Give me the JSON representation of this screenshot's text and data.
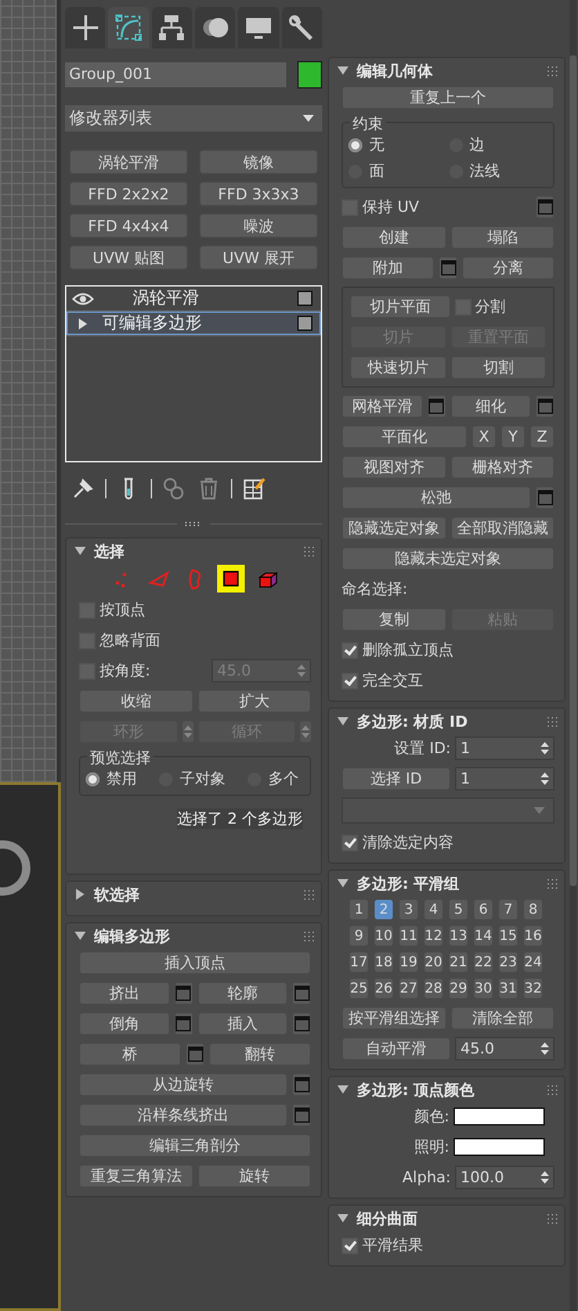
{
  "command_tabs": [
    {
      "kind": "create",
      "selected": false
    },
    {
      "kind": "modify",
      "selected": true
    },
    {
      "kind": "hierarchy",
      "selected": false
    },
    {
      "kind": "motion",
      "selected": false
    },
    {
      "kind": "display",
      "selected": false
    },
    {
      "kind": "utilities",
      "selected": false
    }
  ],
  "object": {
    "name": "Group_001",
    "color": "#2db82d"
  },
  "modifier_list": {
    "value": "修改器列表"
  },
  "modifier_buttons": [
    "涡轮平滑",
    "镜像",
    "FFD 2x2x2",
    "FFD 3x3x3",
    "FFD 4x4x4",
    "噪波",
    "UVW 贴图",
    "UVW 展开"
  ],
  "modifier_stack": [
    {
      "kind": "modifier",
      "label": "涡轮平滑",
      "selected": false
    },
    {
      "kind": "base",
      "label": "可编辑多边形",
      "selected": true
    }
  ],
  "left_rollouts": [
    {
      "title": "选择",
      "expanded": true,
      "rows": [
        {
          "kind": "subobjects",
          "levels": [
            {
              "kind": "vertex",
              "selected": false
            },
            {
              "kind": "edge",
              "selected": false
            },
            {
              "kind": "border",
              "selected": false
            },
            {
              "kind": "polygon",
              "selected": true
            },
            {
              "kind": "element",
              "selected": false
            }
          ]
        },
        {
          "kind": "row",
          "items": [
            {
              "kind": "checkbox",
              "label": "按顶点",
              "checked": false
            }
          ]
        },
        {
          "kind": "row",
          "items": [
            {
              "kind": "checkbox",
              "label": "忽略背面",
              "checked": false
            }
          ]
        },
        {
          "kind": "row",
          "items": [
            {
              "kind": "checkbox",
              "label": "按角度:",
              "checked": false
            },
            {
              "kind": "spinner",
              "value": "45.0",
              "disabled": true
            }
          ]
        },
        {
          "kind": "row",
          "items": [
            {
              "kind": "button",
              "label": "收缩",
              "disabled": false
            },
            {
              "kind": "button",
              "label": "扩大",
              "disabled": false
            }
          ]
        },
        {
          "kind": "row",
          "items": [
            {
              "kind": "button",
              "label": "环形",
              "disabled": true
            },
            {
              "kind": "stepper",
              "disabled": true
            },
            {
              "kind": "button",
              "label": "循环",
              "disabled": true
            },
            {
              "kind": "stepper",
              "disabled": true
            }
          ]
        },
        {
          "kind": "radios",
          "title": "预览选择",
          "options": [
            {
              "label": "禁用",
              "selected": true
            },
            {
              "label": "子对象",
              "selected": false
            },
            {
              "label": "多个",
              "selected": false
            }
          ]
        },
        {
          "kind": "status",
          "text": "选择了 2 个多边形"
        }
      ]
    },
    {
      "title": "软选择",
      "expanded": false
    },
    {
      "title": "编辑多边形",
      "expanded": true,
      "rows": [
        {
          "kind": "row",
          "items": [
            {
              "kind": "button",
              "label": "插入顶点",
              "disabled": false
            }
          ]
        },
        {
          "kind": "row",
          "items": [
            {
              "kind": "button",
              "label": "挤出",
              "disabled": false
            },
            {
              "kind": "settings",
              "disabled": false
            },
            {
              "kind": "button",
              "label": "轮廓",
              "disabled": false
            },
            {
              "kind": "settings",
              "disabled": false
            }
          ]
        },
        {
          "kind": "row",
          "items": [
            {
              "kind": "button",
              "label": "倒角",
              "disabled": false
            },
            {
              "kind": "settings",
              "disabled": false
            },
            {
              "kind": "button",
              "label": "插入",
              "disabled": false
            },
            {
              "kind": "settings",
              "disabled": false
            }
          ]
        },
        {
          "kind": "row",
          "items": [
            {
              "kind": "button",
              "label": "桥",
              "disabled": false
            },
            {
              "kind": "settings",
              "disabled": false
            },
            {
              "kind": "button",
              "label": "翻转",
              "disabled": false
            }
          ]
        },
        {
          "kind": "row",
          "items": [
            {
              "kind": "button",
              "label": "从边旋转",
              "disabled": false
            },
            {
              "kind": "settings",
              "disabled": false
            }
          ]
        },
        {
          "kind": "row",
          "items": [
            {
              "kind": "button",
              "label": "沿样条线挤出",
              "disabled": false
            },
            {
              "kind": "settings",
              "disabled": false
            }
          ]
        },
        {
          "kind": "row",
          "items": [
            {
              "kind": "button",
              "label": "编辑三角剖分",
              "disabled": false
            }
          ]
        },
        {
          "kind": "row",
          "items": [
            {
              "kind": "button",
              "label": "重复三角算法",
              "disabled": false
            },
            {
              "kind": "button",
              "label": "旋转",
              "disabled": false
            }
          ]
        }
      ]
    }
  ],
  "right_rollouts": [
    {
      "title": "编辑几何体",
      "expanded": true,
      "rows": [
        {
          "kind": "row",
          "items": [
            {
              "kind": "button",
              "label": "重复上一个",
              "disabled": false
            }
          ]
        },
        {
          "kind": "radios",
          "title": "约束",
          "options": [
            {
              "label": "无",
              "selected": true
            },
            {
              "label": "边",
              "selected": false
            },
            {
              "label": "面",
              "selected": false
            },
            {
              "label": "法线",
              "selected": false
            }
          ]
        },
        {
          "kind": "row",
          "items": [
            {
              "kind": "checkbox",
              "label": "保持 UV",
              "checked": false
            },
            {
              "kind": "settings",
              "disabled": false
            }
          ]
        },
        {
          "kind": "row",
          "items": [
            {
              "kind": "button",
              "label": "创建",
              "disabled": false
            },
            {
              "kind": "button",
              "label": "塌陷",
              "disabled": false
            }
          ]
        },
        {
          "kind": "row",
          "items": [
            {
              "kind": "button",
              "label": "附加",
              "disabled": false
            },
            {
              "kind": "settings",
              "disabled": false
            },
            {
              "kind": "button",
              "label": "分离",
              "disabled": false
            }
          ]
        },
        {
          "kind": "frame",
          "rows": [
            {
              "kind": "row",
              "items": [
                {
                  "kind": "button",
                  "label": "切片平面",
                  "disabled": false
                },
                {
                  "kind": "checkbox",
                  "label": "分割",
                  "checked": false
                }
              ]
            },
            {
              "kind": "row",
              "items": [
                {
                  "kind": "button",
                  "label": "切片",
                  "disabled": true
                },
                {
                  "kind": "button",
                  "label": "重置平面",
                  "disabled": true
                }
              ]
            },
            {
              "kind": "row",
              "items": [
                {
                  "kind": "button",
                  "label": "快速切片",
                  "disabled": false
                },
                {
                  "kind": "button",
                  "label": "切割",
                  "disabled": false
                }
              ]
            }
          ]
        },
        {
          "kind": "row",
          "items": [
            {
              "kind": "button",
              "label": "网格平滑",
              "disabled": false
            },
            {
              "kind": "settings",
              "disabled": false
            },
            {
              "kind": "button",
              "label": "细化",
              "disabled": false
            },
            {
              "kind": "settings",
              "disabled": false
            }
          ]
        },
        {
          "kind": "row",
          "items": [
            {
              "kind": "button",
              "label": "平面化",
              "disabled": false
            },
            {
              "kind": "small_button",
              "label": "X",
              "disabled": false
            },
            {
              "kind": "small_button",
              "label": "Y",
              "disabled": false
            },
            {
              "kind": "small_button",
              "label": "Z",
              "disabled": false
            }
          ]
        },
        {
          "kind": "row",
          "items": [
            {
              "kind": "button",
              "label": "视图对齐",
              "disabled": false
            },
            {
              "kind": "button",
              "label": "栅格对齐",
              "disabled": false
            }
          ]
        },
        {
          "kind": "row",
          "items": [
            {
              "kind": "button",
              "label": "松弛",
              "disabled": false
            },
            {
              "kind": "settings",
              "disabled": false
            }
          ]
        },
        {
          "kind": "row",
          "items": [
            {
              "kind": "button",
              "label": "隐藏选定对象",
              "disabled": false
            },
            {
              "kind": "button",
              "label": "全部取消隐藏",
              "disabled": false
            }
          ]
        },
        {
          "kind": "row",
          "items": [
            {
              "kind": "button",
              "label": "隐藏未选定对象",
              "disabled": false
            }
          ]
        },
        {
          "kind": "row",
          "items": [
            {
              "kind": "label",
              "text": "命名选择:"
            }
          ]
        },
        {
          "kind": "row",
          "items": [
            {
              "kind": "button",
              "label": "复制",
              "disabled": false
            },
            {
              "kind": "button",
              "label": "粘贴",
              "disabled": true
            }
          ]
        },
        {
          "kind": "row",
          "items": [
            {
              "kind": "checkbox",
              "label": "删除孤立顶点",
              "checked": true
            }
          ]
        },
        {
          "kind": "row",
          "items": [
            {
              "kind": "checkbox",
              "label": "完全交互",
              "checked": true
            }
          ]
        }
      ]
    },
    {
      "title": "多边形: 材质 ID",
      "expanded": true,
      "rows": [
        {
          "kind": "row",
          "items": [
            {
              "kind": "label",
              "text": "设置 ID:"
            },
            {
              "kind": "spinner",
              "value": "1",
              "disabled": false
            }
          ]
        },
        {
          "kind": "row",
          "items": [
            {
              "kind": "button",
              "label": "选择 ID",
              "disabled": false
            },
            {
              "kind": "spinner",
              "value": "1",
              "disabled": false
            }
          ]
        },
        {
          "kind": "row",
          "items": [
            {
              "kind": "dropdown",
              "disabled": true
            }
          ]
        },
        {
          "kind": "row",
          "items": [
            {
              "kind": "checkbox",
              "label": "清除选定内容",
              "checked": true
            }
          ]
        }
      ]
    },
    {
      "title": "多边形: 平滑组",
      "expanded": true,
      "rows": [
        {
          "kind": "grid",
          "cells": [
            {
              "label": "1",
              "selected": false
            },
            {
              "label": "2",
              "selected": true
            },
            {
              "label": "3",
              "selected": false
            },
            {
              "label": "4",
              "selected": false
            },
            {
              "label": "5",
              "selected": false
            },
            {
              "label": "6",
              "selected": false
            },
            {
              "label": "7",
              "selected": false
            },
            {
              "label": "8",
              "selected": false
            },
            {
              "label": "9",
              "selected": false
            },
            {
              "label": "10",
              "selected": false
            },
            {
              "label": "11",
              "selected": false
            },
            {
              "label": "12",
              "selected": false
            },
            {
              "label": "13",
              "selected": false
            },
            {
              "label": "14",
              "selected": false
            },
            {
              "label": "15",
              "selected": false
            },
            {
              "label": "16",
              "selected": false
            },
            {
              "label": "17",
              "selected": false
            },
            {
              "label": "18",
              "selected": false
            },
            {
              "label": "19",
              "selected": false
            },
            {
              "label": "20",
              "selected": false
            },
            {
              "label": "21",
              "selected": false
            },
            {
              "label": "22",
              "selected": false
            },
            {
              "label": "23",
              "selected": false
            },
            {
              "label": "24",
              "selected": false
            },
            {
              "label": "25",
              "selected": false
            },
            {
              "label": "26",
              "selected": false
            },
            {
              "label": "27",
              "selected": false
            },
            {
              "label": "28",
              "selected": false
            },
            {
              "label": "29",
              "selected": false
            },
            {
              "label": "30",
              "selected": false
            },
            {
              "label": "31",
              "selected": false
            },
            {
              "label": "32",
              "selected": false
            }
          ]
        },
        {
          "kind": "row",
          "items": [
            {
              "kind": "button",
              "label": "按平滑组选择",
              "disabled": false
            },
            {
              "kind": "button",
              "label": "清除全部",
              "disabled": false
            }
          ]
        },
        {
          "kind": "row",
          "items": [
            {
              "kind": "button",
              "label": "自动平滑",
              "disabled": false
            },
            {
              "kind": "spinner",
              "value": "45.0",
              "disabled": false
            }
          ]
        }
      ]
    },
    {
      "title": "多边形: 顶点颜色",
      "expanded": true,
      "rows": [
        {
          "kind": "row",
          "items": [
            {
              "kind": "label",
              "text": "颜色:"
            },
            {
              "kind": "color",
              "color": "#ffffff"
            }
          ]
        },
        {
          "kind": "row",
          "items": [
            {
              "kind": "label",
              "text": "照明:"
            },
            {
              "kind": "color",
              "color": "#ffffff"
            }
          ]
        },
        {
          "kind": "row",
          "items": [
            {
              "kind": "label",
              "text": "Alpha:"
            },
            {
              "kind": "spinner",
              "value": "100.0",
              "disabled": false
            }
          ]
        }
      ]
    },
    {
      "title": "细分曲面",
      "expanded": true,
      "rows": [
        {
          "kind": "row",
          "items": [
            {
              "kind": "checkbox",
              "label": "平滑结果",
              "checked": true
            }
          ]
        }
      ]
    }
  ]
}
